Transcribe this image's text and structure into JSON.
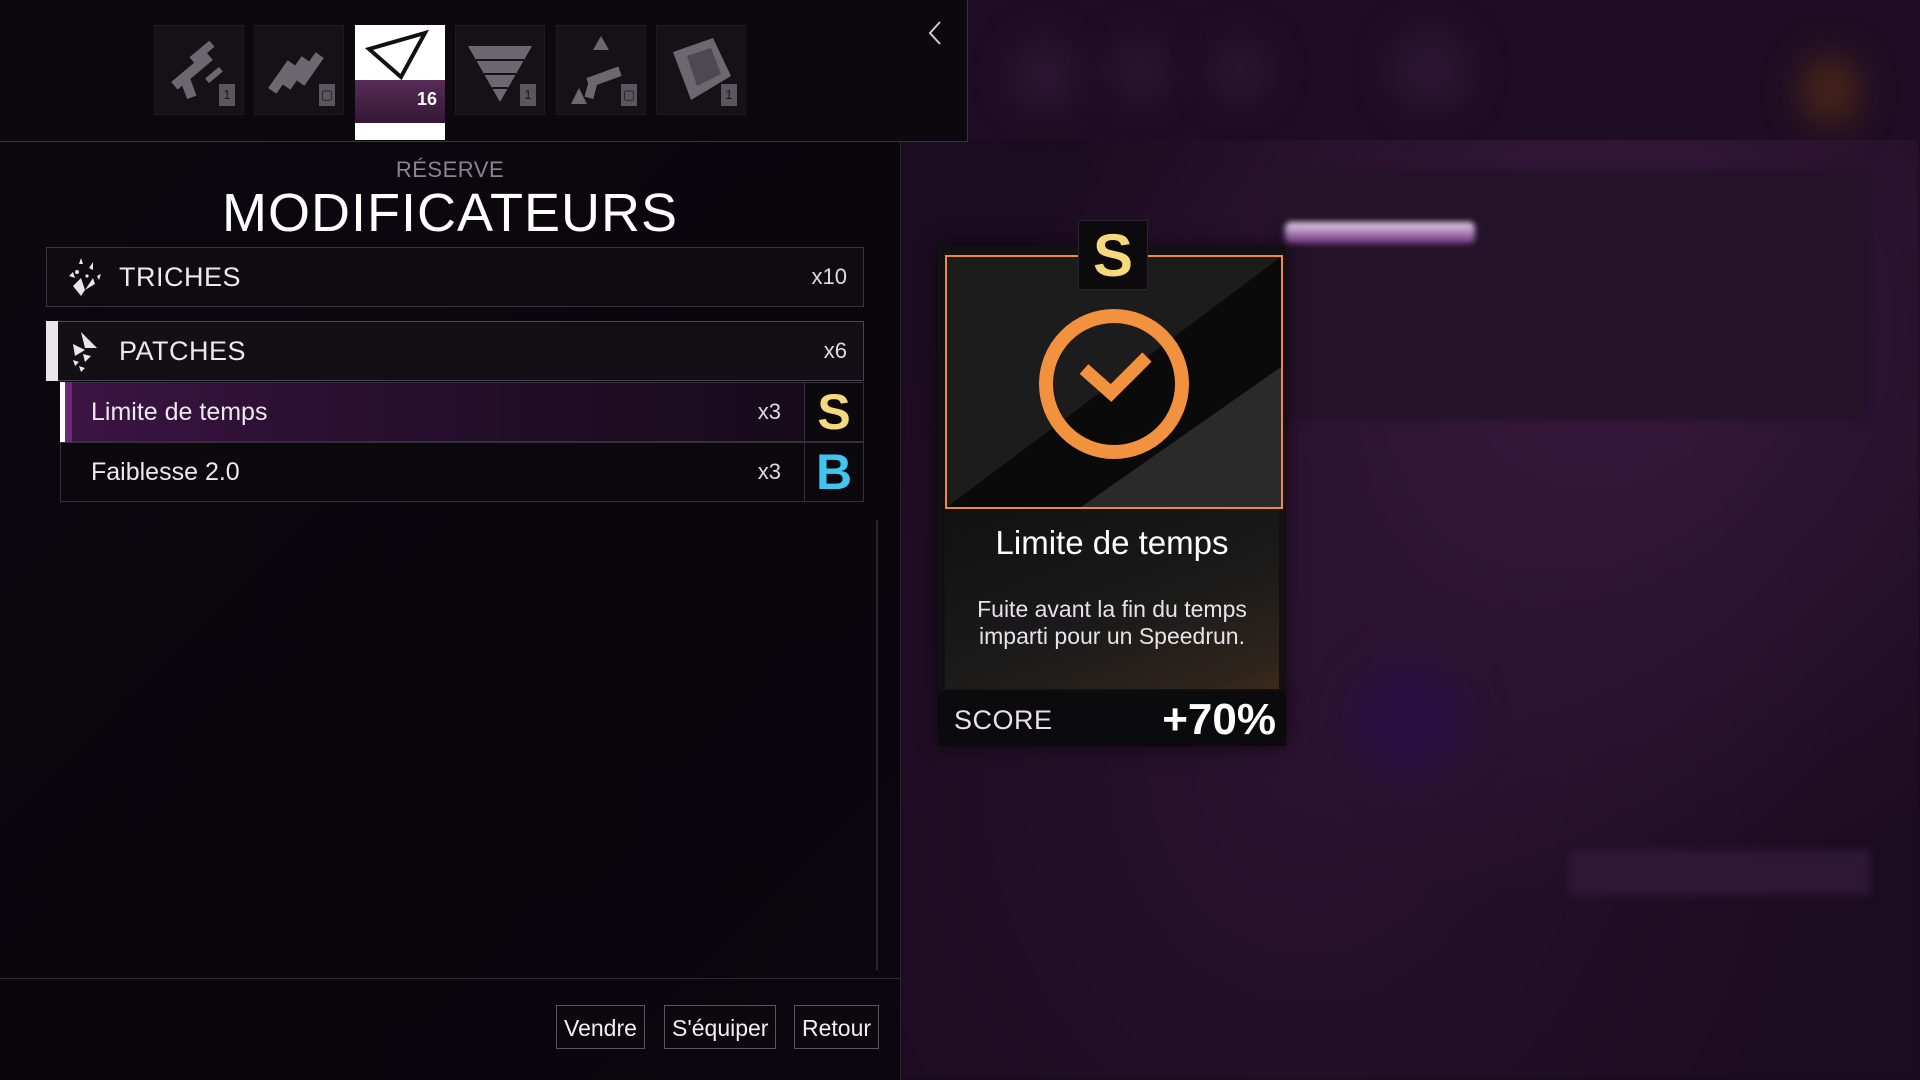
{
  "tabs": [
    {
      "name": "weapon-scope",
      "badge": "1"
    },
    {
      "name": "ammo",
      "badge": "▢"
    },
    {
      "name": "modifiers",
      "badge": "16",
      "active": true
    },
    {
      "name": "pyramid",
      "badge": "1"
    },
    {
      "name": "pistol-shapes",
      "badge": "▢"
    },
    {
      "name": "cube",
      "badge": "1"
    }
  ],
  "header": {
    "section": "RÉSERVE",
    "title": "MODIFICATEURS"
  },
  "categories": [
    {
      "label": "TRICHES",
      "qty": "x10"
    },
    {
      "label": "PATCHES",
      "qty": "x6"
    }
  ],
  "items": [
    {
      "label": "Limite de temps",
      "qty": "x3",
      "grade": "S"
    },
    {
      "label": "Faiblesse 2.0",
      "qty": "x3",
      "grade": "B"
    }
  ],
  "buttons": {
    "sell": "Vendre",
    "equip": "S'équiper",
    "back": "Retour"
  },
  "card": {
    "grade": "S",
    "title": "Limite de temps",
    "description": "Fuite avant la fin du temps imparti pour un Speedrun.",
    "score_label": "SCORE",
    "score_value": "+70%"
  },
  "colors": {
    "grade_s": "#f6d97e",
    "grade_b": "#3ec6f0",
    "accent_orange": "#f08a38",
    "selected_purple": "#3c1444"
  },
  "icons": {
    "back": "chevron-left-icon",
    "clock": "clock-check-icon",
    "cheats": "cheats-sparkle-icon",
    "patches": "patches-shards-icon"
  }
}
